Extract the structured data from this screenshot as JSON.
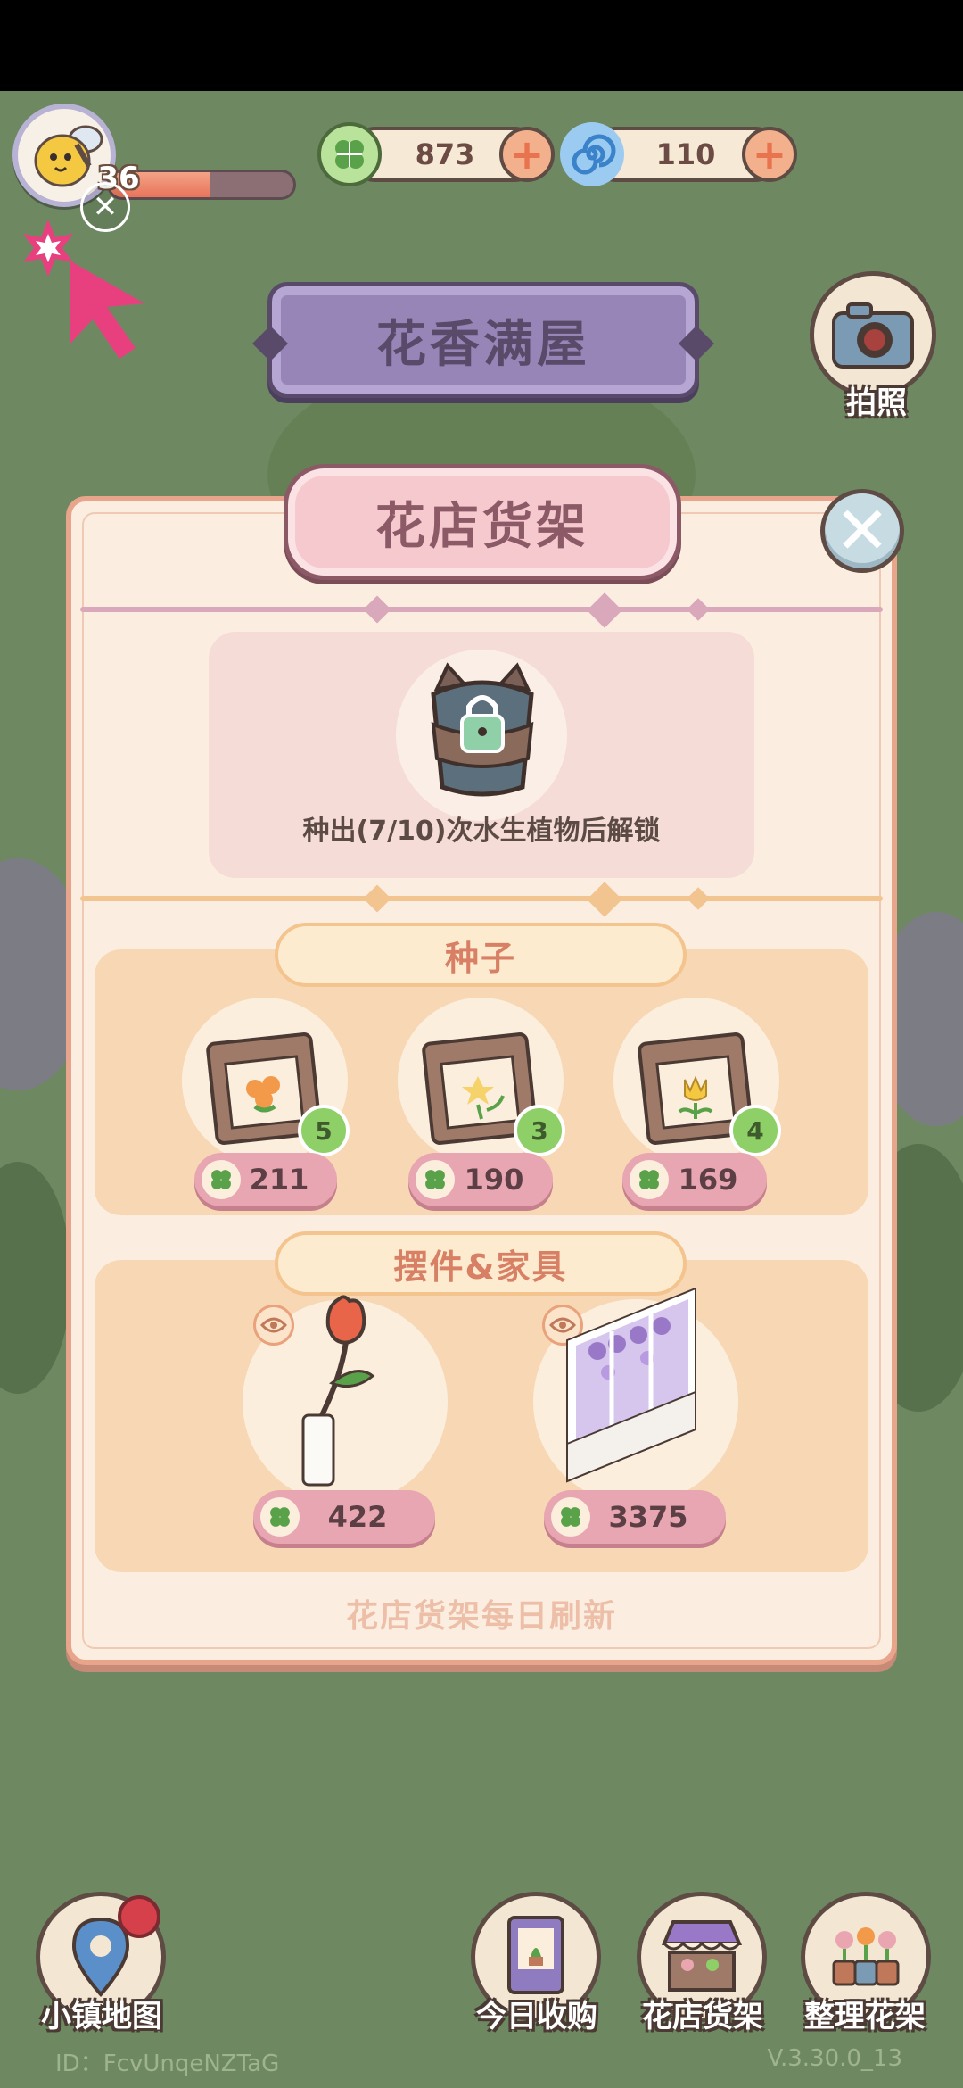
{
  "hud": {
    "level": "36",
    "level_progress": 0.55,
    "clover_currency": "873",
    "spiral_currency": "110"
  },
  "banner": {
    "title": "花香满屋"
  },
  "camera": {
    "label": "拍照"
  },
  "panel": {
    "title": "花店货架",
    "locked_slot": {
      "text": "种出(7/10)次水生植物后解锁"
    },
    "seeds_section": {
      "label": "种子",
      "items": [
        {
          "name": "orange-flower-seeds",
          "count": "5",
          "price": "211"
        },
        {
          "name": "daffodil-seeds",
          "count": "3",
          "price": "190"
        },
        {
          "name": "tulip-seeds",
          "count": "4",
          "price": "169"
        }
      ]
    },
    "furniture_section": {
      "label": "摆件&家具",
      "items": [
        {
          "name": "tulip-vase",
          "price": "422"
        },
        {
          "name": "wisteria-window",
          "price": "3375"
        }
      ]
    },
    "footer": "花店货架每日刷新"
  },
  "bottom_nav": {
    "town_map": "小镇地图",
    "today_harvest": "今日收购",
    "shop_shelf": "花店货架",
    "arrange_shelf": "整理花架"
  },
  "footer_info": {
    "id": "ID：FcvUnqeNZTaG",
    "version": "V.3.30.0_13"
  },
  "colors": {
    "background": "#6e8962",
    "panel": "#fbeee0",
    "accent_pink": "#e7a6b1",
    "banner_purple": "#9885b8"
  }
}
